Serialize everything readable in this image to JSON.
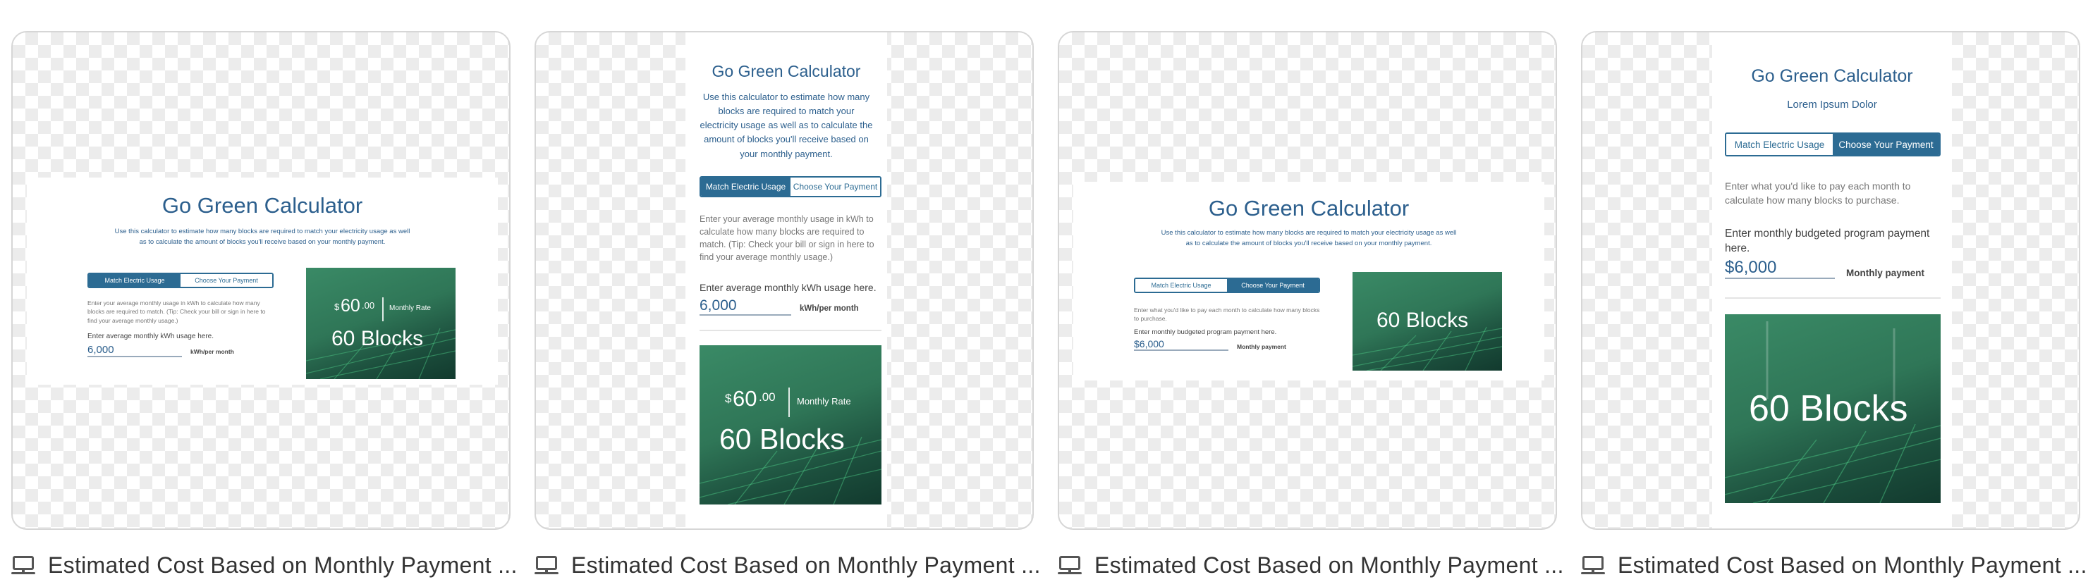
{
  "calculator": {
    "title": "Go Green Calculator",
    "subtitle": "Lorem Ipsum Dolor",
    "description": "Use this calculator to estimate how many blocks are required to match your electricity usage as well as to calculate the amount of blocks you'll receive based on your monthly payment.",
    "tab_usage": "Match Electric Usage",
    "tab_payment": "Choose Your Payment",
    "usage_help": "Enter your average monthly usage in kWh to calculate how many blocks are required to match. (Tip: Check your bill or sign in here to find your average monthly usage.)",
    "usage_label": "Enter average monthly kWh usage here.",
    "usage_value": "6,000",
    "usage_unit": "kWh/per month",
    "payment_help": "Enter what you'd like to pay each month to calculate how many blocks to purchase.",
    "payment_label": "Enter monthly budgeted program payment here.",
    "payment_value": "$6,000",
    "payment_unit": "Monthly payment",
    "rate_currency": "$",
    "rate_whole": "60",
    "rate_cents": ".00",
    "rate_label": "Monthly Rate",
    "blocks": "60 Blocks"
  },
  "cards": [
    {
      "caption": "Estimated Cost Based on Monthly Payment ..."
    },
    {
      "caption": "Estimated Cost Based on Monthly Payment ..."
    },
    {
      "caption": "Estimated Cost Based on Monthly Payment ..."
    },
    {
      "caption": "Estimated Cost Based on Monthly Payment ..."
    }
  ],
  "icons": {
    "caption_icon": "desktop-icon"
  },
  "colors": {
    "accent": "#2c6b93",
    "title": "#2c5f8d",
    "tile_green": "#2f7657"
  }
}
